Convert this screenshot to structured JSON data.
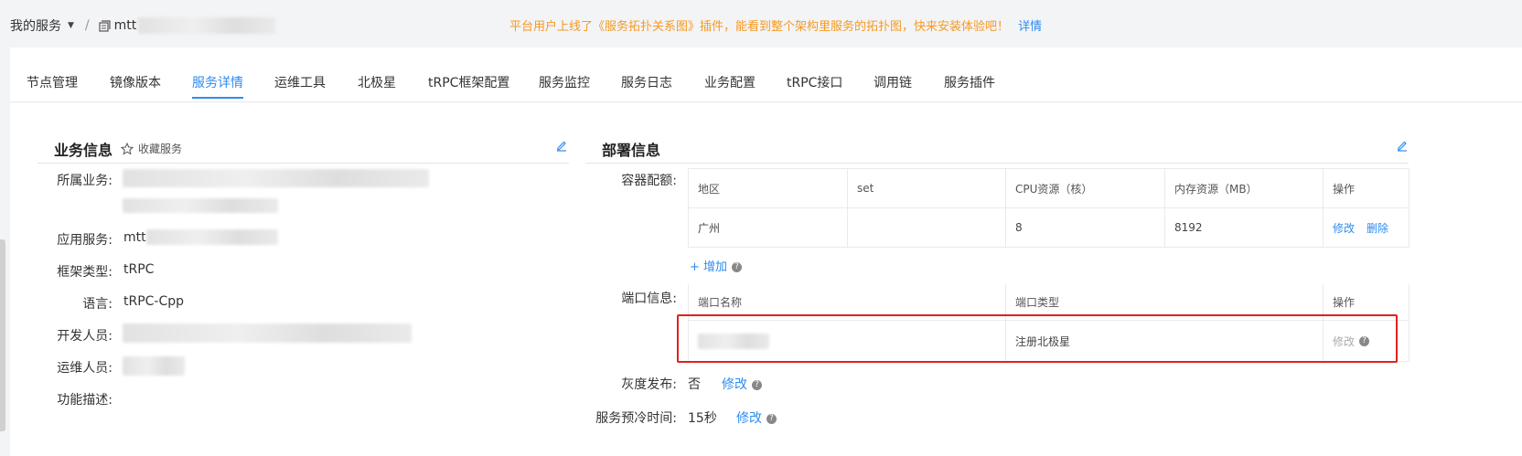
{
  "breadcrumb": {
    "root": "我的服务",
    "caret": "▼",
    "separator": "/",
    "service_prefix": "mtt"
  },
  "notice": {
    "text": "平台用户上线了《服务拓扑关系图》插件，能看到整个架构里服务的拓扑图，快来安装体验吧！",
    "link": "详情"
  },
  "tabs": [
    "节点管理",
    "镜像版本",
    "服务详情",
    "运维工具",
    "北极星",
    "tRPC框架配置",
    "服务监控",
    "服务日志",
    "业务配置",
    "tRPC接口",
    "调用链",
    "服务插件"
  ],
  "active_tab": "服务详情",
  "business": {
    "title": "业务信息",
    "favorite": "收藏服务",
    "fields": {
      "belong_label": "所属业务:",
      "app_label": "应用服务:",
      "app_prefix": "mtt",
      "framework_label": "框架类型:",
      "framework_value": "tRPC",
      "lang_label": "语言:",
      "lang_value": "tRPC-Cpp",
      "dev_label": "开发人员:",
      "ops_label": "运维人员:",
      "desc_label": "功能描述:"
    }
  },
  "deploy": {
    "title": "部署信息",
    "quota_label": "容器配额:",
    "quota_headers": [
      "地区",
      "set",
      "CPU资源（核）",
      "内存资源（MB）",
      "操作"
    ],
    "quota_rows": [
      {
        "region": "广州",
        "set": "",
        "cpu": "8",
        "mem": "8192",
        "edit": "修改",
        "delete": "删除"
      }
    ],
    "add_label": "+ 增加",
    "port_label": "端口信息:",
    "port_headers": [
      "端口名称",
      "端口类型",
      "操作"
    ],
    "port_rows": [
      {
        "type": "注册北极星",
        "edit": "修改"
      }
    ],
    "gray_label": "灰度发布:",
    "gray_value": "否",
    "gray_edit": "修改",
    "prewarm_label": "服务预冷时间:",
    "prewarm_value": "15秒",
    "prewarm_edit": "修改"
  },
  "colors": {
    "accent": "#2d8cf0",
    "notice": "#f59a23",
    "highlight_box": "#e02020"
  }
}
